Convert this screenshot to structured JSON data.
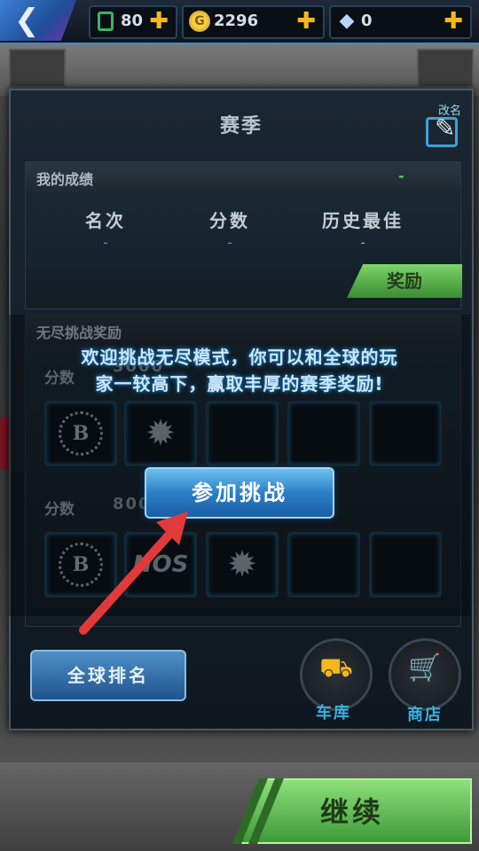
{
  "topbar": {
    "back_label": "❮",
    "fuel": {
      "value": "80",
      "plus": "✚",
      "icon": "fuel-icon"
    },
    "coins": {
      "value": "2296",
      "plus": "✚",
      "icon": "coin-icon",
      "coin_glyph": "G"
    },
    "gems": {
      "value": "0",
      "plus": "✚",
      "icon": "diamond-icon"
    }
  },
  "panel": {
    "title": "赛季",
    "rename_label": "改名",
    "my_results": {
      "header": "我的成绩",
      "header_dash": "-",
      "col_rank": "名次",
      "col_score": "分数",
      "col_best": "历史最佳",
      "rank_value": "-",
      "score_value": "-",
      "best_value": "-",
      "reward_button": "奖励"
    },
    "endless": {
      "header": "无尽挑战奖励",
      "rows": [
        {
          "label": "分数",
          "value": "3000",
          "slots": [
            "b-badge",
            "gear",
            "",
            "",
            ""
          ]
        },
        {
          "label": "分数",
          "value": "800",
          "slots": [
            "b-badge",
            "nos",
            "gear",
            "",
            ""
          ]
        }
      ],
      "b_glyph": "B",
      "nos_text": "NOS",
      "gear_glyph": "✹"
    },
    "welcome_line1": "欢迎挑战无尽模式，你可以和全球的玩",
    "welcome_line2": "家一较高下，赢取丰厚的赛季奖励!",
    "join_button": "参加挑战",
    "global_rank_button": "全球排名",
    "garage_label": "车库",
    "shop_label": "商店",
    "garage_icon": "garage-icon",
    "shop_icon": "cart-icon"
  },
  "continue_button": "继续",
  "colors": {
    "accent_blue": "#2b7ec7",
    "accent_green": "#3d9a37",
    "gold": "#f2b81d",
    "arrow_red": "#e23a3a"
  }
}
